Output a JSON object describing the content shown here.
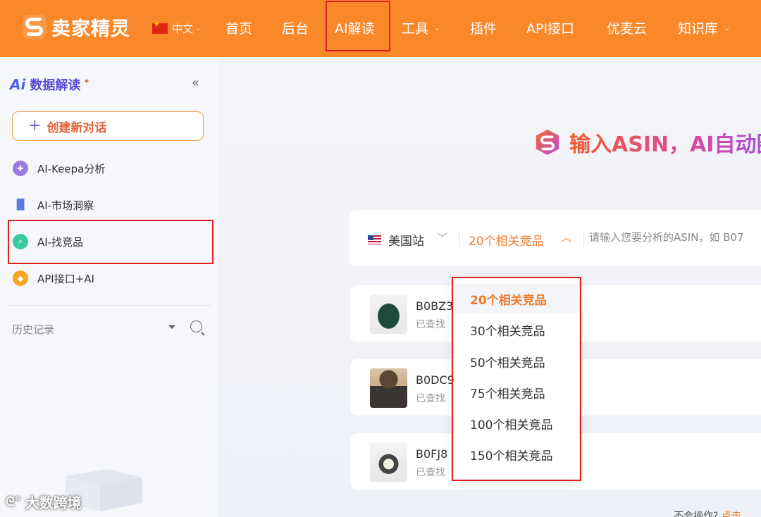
{
  "app": {
    "logo_text": "卖家精灵",
    "language": "中文"
  },
  "nav": {
    "items": [
      {
        "label": "首页"
      },
      {
        "label": "后台"
      },
      {
        "label": "AI解读"
      },
      {
        "label": "工具"
      },
      {
        "label": "插件"
      },
      {
        "label": "API接口"
      },
      {
        "label": "优麦云"
      },
      {
        "label": "知识库"
      }
    ]
  },
  "sidebar": {
    "badge": "Ai",
    "title": "数据解读",
    "collapse_icon": "«",
    "new_chat_label": "创建新对话",
    "items": [
      {
        "label": "AI-Keepa分析",
        "icon": "keepa-icon"
      },
      {
        "label": "AI-市场洞察",
        "icon": "bar-chart-icon"
      },
      {
        "label": "AI-找竞品",
        "icon": "find-competitor-icon"
      },
      {
        "label": "API接口+AI",
        "icon": "api-icon"
      }
    ],
    "history_label": "历史记录"
  },
  "main": {
    "hero_title": "输入ASIN，AI自动圈",
    "search": {
      "site_label": "美国站",
      "count_label": "20个相关竞品",
      "placeholder": "请输入您要分析的ASIN，如 B07"
    },
    "cards": [
      {
        "asin": "B0BZ3",
        "status": "已查找"
      },
      {
        "asin": "B0DC9",
        "status": "已查找"
      },
      {
        "asin": "B0FJ8",
        "status": "已查找"
      }
    ],
    "dropdown_options": [
      {
        "label": "20个相关竞品",
        "selected": true
      },
      {
        "label": "30个相关竞品",
        "selected": false
      },
      {
        "label": "50个相关竞品",
        "selected": false
      },
      {
        "label": "75个相关竞品",
        "selected": false
      },
      {
        "label": "100个相关竞品",
        "selected": false
      },
      {
        "label": "150个相关竞品",
        "selected": false
      }
    ],
    "footer_hint_prefix": "不会操作?",
    "footer_hint_link": "点击"
  },
  "watermark": "大数跨境",
  "colors": {
    "brand_orange": "#f9882a",
    "highlight_red": "#e02020",
    "accent_orange": "#f07a2a"
  }
}
